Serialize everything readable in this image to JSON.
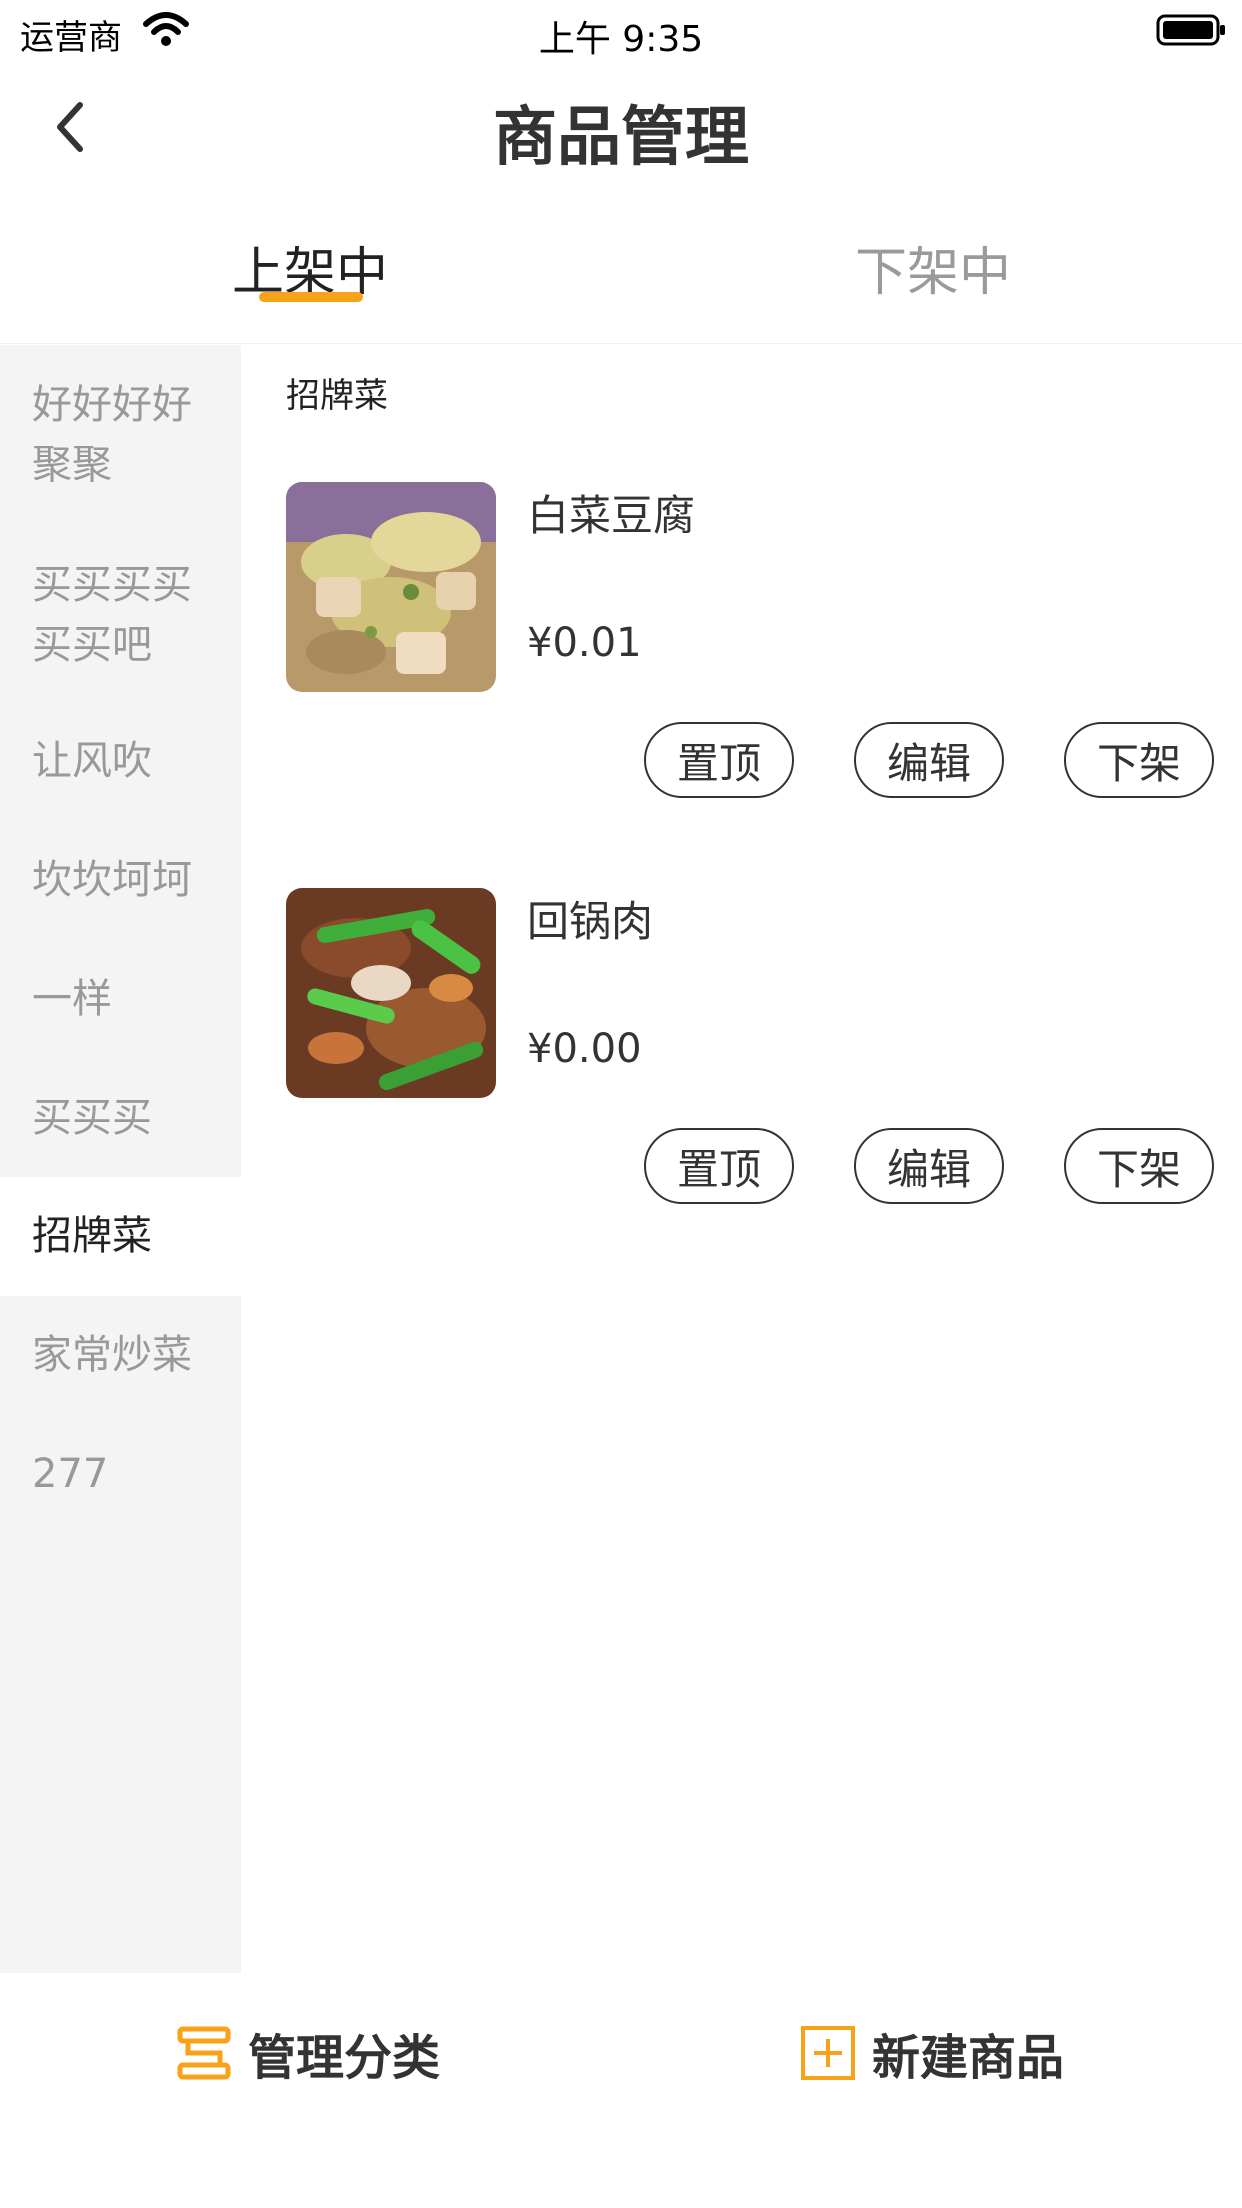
{
  "status_bar": {
    "carrier": "运营商",
    "time": "上午 9:35"
  },
  "header": {
    "title": "商品管理"
  },
  "tabs": [
    {
      "label": "上架中",
      "active": true
    },
    {
      "label": "下架中",
      "active": false
    }
  ],
  "sidebar": {
    "items": [
      {
        "label": "好好好好聚聚",
        "active": false
      },
      {
        "label": "买买买买买买吧",
        "active": false
      },
      {
        "label": "让风吹",
        "active": false
      },
      {
        "label": "坎坎坷坷",
        "active": false
      },
      {
        "label": "一样",
        "active": false
      },
      {
        "label": "买买买",
        "active": false
      },
      {
        "label": "招牌菜",
        "active": true
      },
      {
        "label": "家常炒菜",
        "active": false
      },
      {
        "label": "277",
        "active": false
      }
    ]
  },
  "content": {
    "section_title": "招牌菜",
    "products": [
      {
        "name": "白菜豆腐",
        "price": "¥0.01",
        "actions": [
          "置顶",
          "编辑",
          "下架"
        ]
      },
      {
        "name": "回锅肉",
        "price": "¥0.00",
        "actions": [
          "置顶",
          "编辑",
          "下架"
        ]
      }
    ]
  },
  "bottom_bar": {
    "manage_category": "管理分类",
    "new_product": "新建商品"
  },
  "colors": {
    "accent": "#f8a21a",
    "sidebar_bg": "#f4f4f4",
    "inactive_text": "#999999"
  }
}
